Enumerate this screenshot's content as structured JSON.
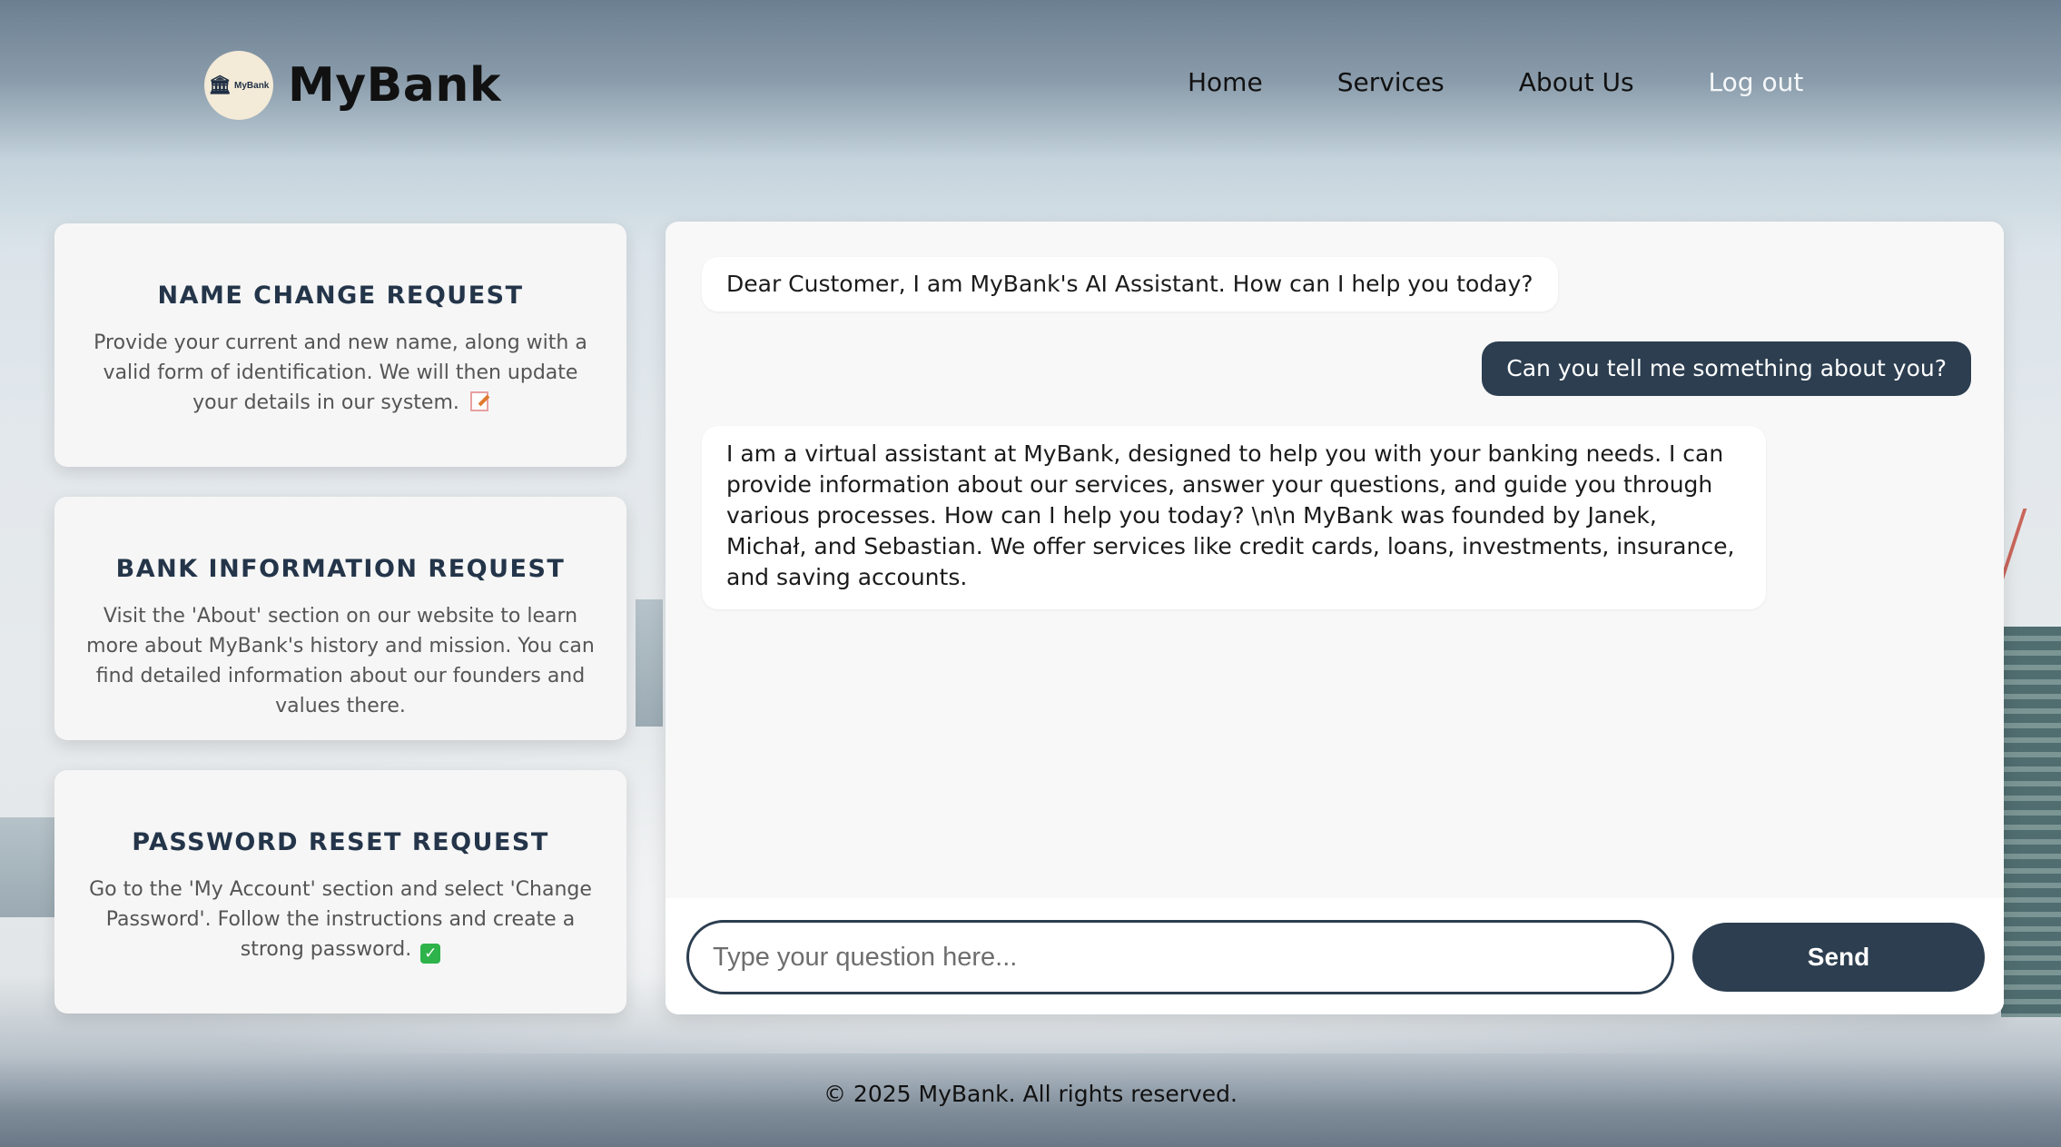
{
  "header": {
    "logo_text": "MyBank",
    "brand": "MyBank",
    "nav": [
      "Home",
      "Services",
      "About Us",
      "Log out"
    ]
  },
  "cards": [
    {
      "title": "NAME CHANGE REQUEST",
      "body": "Provide your current and new name, along with a valid form of identification. We will then update your details in our system.",
      "icon": "memo-icon"
    },
    {
      "title": "BANK INFORMATION REQUEST",
      "body": "Visit the 'About' section on our website to learn more about MyBank's history and mission. You can find detailed information about our founders and values there.",
      "icon": ""
    },
    {
      "title": "PASSWORD RESET REQUEST",
      "body": "Go to the 'My Account' section and select 'Change Password'. Follow the instructions and create a strong password.",
      "icon": "check-icon"
    }
  ],
  "chat": {
    "messages": [
      {
        "role": "bot",
        "text": "Dear Customer, I am MyBank's AI Assistant. How can I help you today?"
      },
      {
        "role": "user",
        "text": "Can you tell me something about you?"
      },
      {
        "role": "bot",
        "text": "I am a virtual assistant at MyBank, designed to help you with your banking needs. I can provide information about our services, answer your questions, and guide you through various processes. How can I help you today? \\n\\n MyBank was founded by Janek, Michał, and Sebastian. We offer services like credit cards, loans, investments, insurance, and saving accounts."
      }
    ],
    "input_placeholder": "Type your question here...",
    "input_value": "",
    "send_label": "Send"
  },
  "footer": {
    "text": "© 2025 MyBank. All rights reserved."
  },
  "colors": {
    "accent": "#2c3e50",
    "card_bg": "#f6f6f6",
    "logo_bg": "#f3ead7"
  }
}
